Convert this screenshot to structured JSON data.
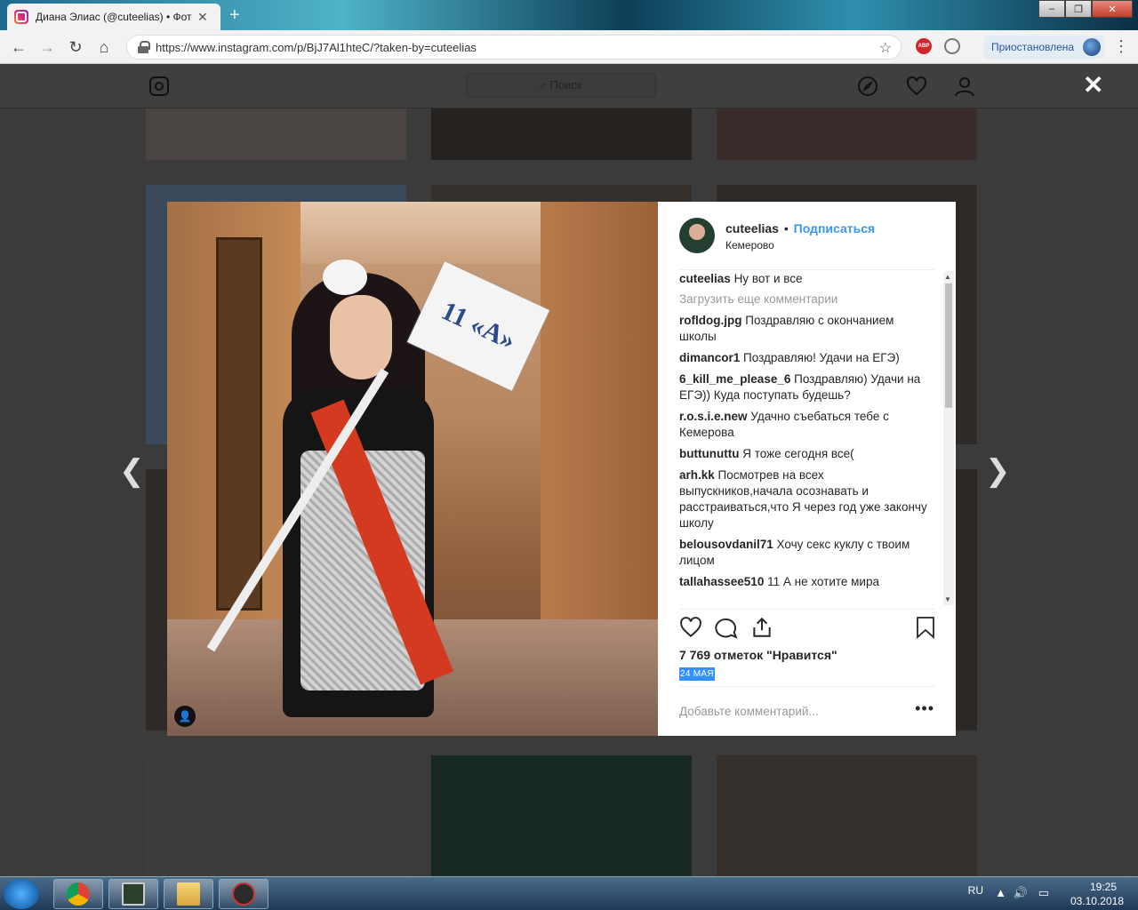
{
  "browser": {
    "tab_title": "Диана Элиас (@cuteelias) • Фото",
    "tab_close": "✕",
    "new_tab": "+",
    "url": "https://www.instagram.com/p/BjJ7Al1hteC/?taken-by=cuteelias",
    "ext_abp": "ABP",
    "profile_status": "Приостановлена"
  },
  "instagram": {
    "search_placeholder": "Поиск",
    "close_label": "✕"
  },
  "post": {
    "sign_text": "11 «А»",
    "username": "cuteelias",
    "follow_label": "Подписаться",
    "location": "Кемерово",
    "load_more": "Загрузить еще комментарии",
    "caption": {
      "user": "cuteelias",
      "text": "Ну вот и все"
    },
    "comments": [
      {
        "user": "rofldog.jpg",
        "text": "Поздравляю с окончанием школы"
      },
      {
        "user": "dimancor1",
        "text": "Поздравляю! Удачи на ЕГЭ)"
      },
      {
        "user": "6_kill_me_please_6",
        "text": "Поздравляю) Удачи на ЕГЭ)) Куда поступать будешь?"
      },
      {
        "user": "r.o.s.i.e.new",
        "text": "Удачно съебаться тебе с Кемерова"
      },
      {
        "user": "buttunuttu",
        "text": "Я тоже сегодня все("
      },
      {
        "user": "arh.kk",
        "text": "Посмотрев на всех выпускников,начала осознавать и расстраиваться,что Я через год уже закончу школу"
      },
      {
        "user": "belousovdanil71",
        "text": "Хочу секс куклу с твоим лицом"
      },
      {
        "user": "tallahassee510",
        "text": "11 А не хотите мира"
      }
    ],
    "likes": "7 769 отметок \"Нравится\"",
    "date": "24 МАЯ",
    "add_comment_placeholder": "Добавьте комментарий...",
    "more": "•••"
  },
  "taskbar": {
    "lang": "RU",
    "time": "19:25",
    "date": "03.10.2018"
  }
}
